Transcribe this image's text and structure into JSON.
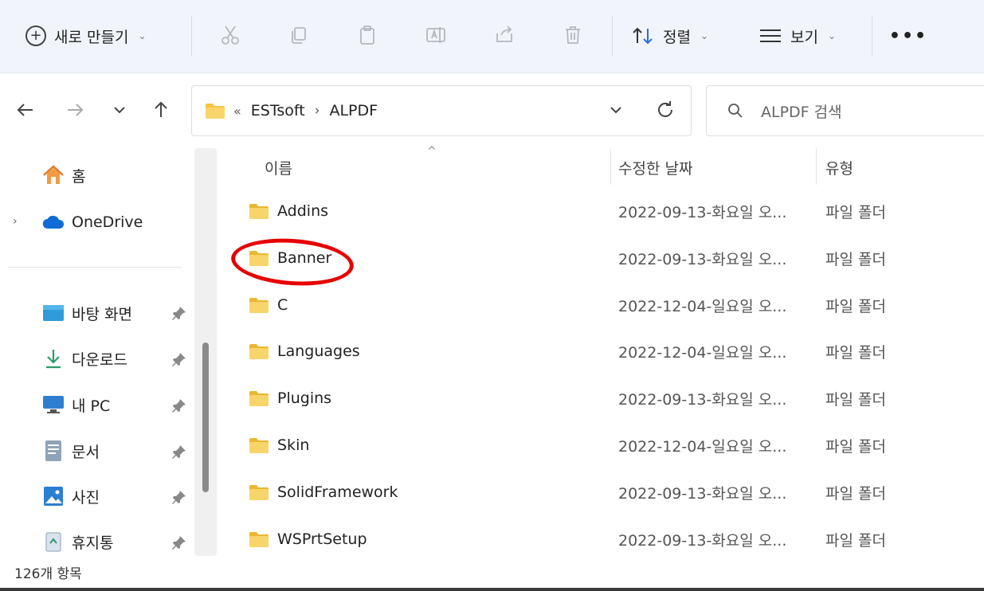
{
  "toolbar": {
    "new_label": "새로 만들기",
    "sort_label": "정렬",
    "view_label": "보기",
    "more_label": "•••"
  },
  "address": {
    "overflow": "«",
    "crumbs": [
      "ESTsoft",
      "ALPDF"
    ]
  },
  "search": {
    "placeholder": "ALPDF 검색"
  },
  "sidebar": {
    "home": "홈",
    "onedrive": "OneDrive",
    "quick": [
      {
        "label": "바탕 화면",
        "icon": "desktop-icon"
      },
      {
        "label": "다운로드",
        "icon": "download-icon"
      },
      {
        "label": "내 PC",
        "icon": "pc-icon"
      },
      {
        "label": "문서",
        "icon": "document-icon"
      },
      {
        "label": "사진",
        "icon": "pictures-icon"
      },
      {
        "label": "휴지통",
        "icon": "recycle-bin-icon"
      }
    ]
  },
  "columns": {
    "name": "이름",
    "date": "수정한 날짜",
    "type": "유형"
  },
  "files": [
    {
      "name": "Addins",
      "date": "2022-09-13-화요일 오...",
      "type": "파일 폴더"
    },
    {
      "name": "Banner",
      "date": "2022-09-13-화요일 오...",
      "type": "파일 폴더"
    },
    {
      "name": "C",
      "date": "2022-12-04-일요일 오...",
      "type": "파일 폴더"
    },
    {
      "name": "Languages",
      "date": "2022-12-04-일요일 오...",
      "type": "파일 폴더"
    },
    {
      "name": "Plugins",
      "date": "2022-09-13-화요일 오...",
      "type": "파일 폴더"
    },
    {
      "name": "Skin",
      "date": "2022-12-04-일요일 오...",
      "type": "파일 폴더"
    },
    {
      "name": "SolidFramework",
      "date": "2022-09-13-화요일 오...",
      "type": "파일 폴더"
    },
    {
      "name": "WSPrtSetup",
      "date": "2022-09-13-화요일 오...",
      "type": "파일 폴더"
    }
  ],
  "status": {
    "count": "126개 항목"
  },
  "colors": {
    "folder": "#f4c542",
    "highlight": "#e60000",
    "toolbar_bg": "#f1f5fb"
  }
}
